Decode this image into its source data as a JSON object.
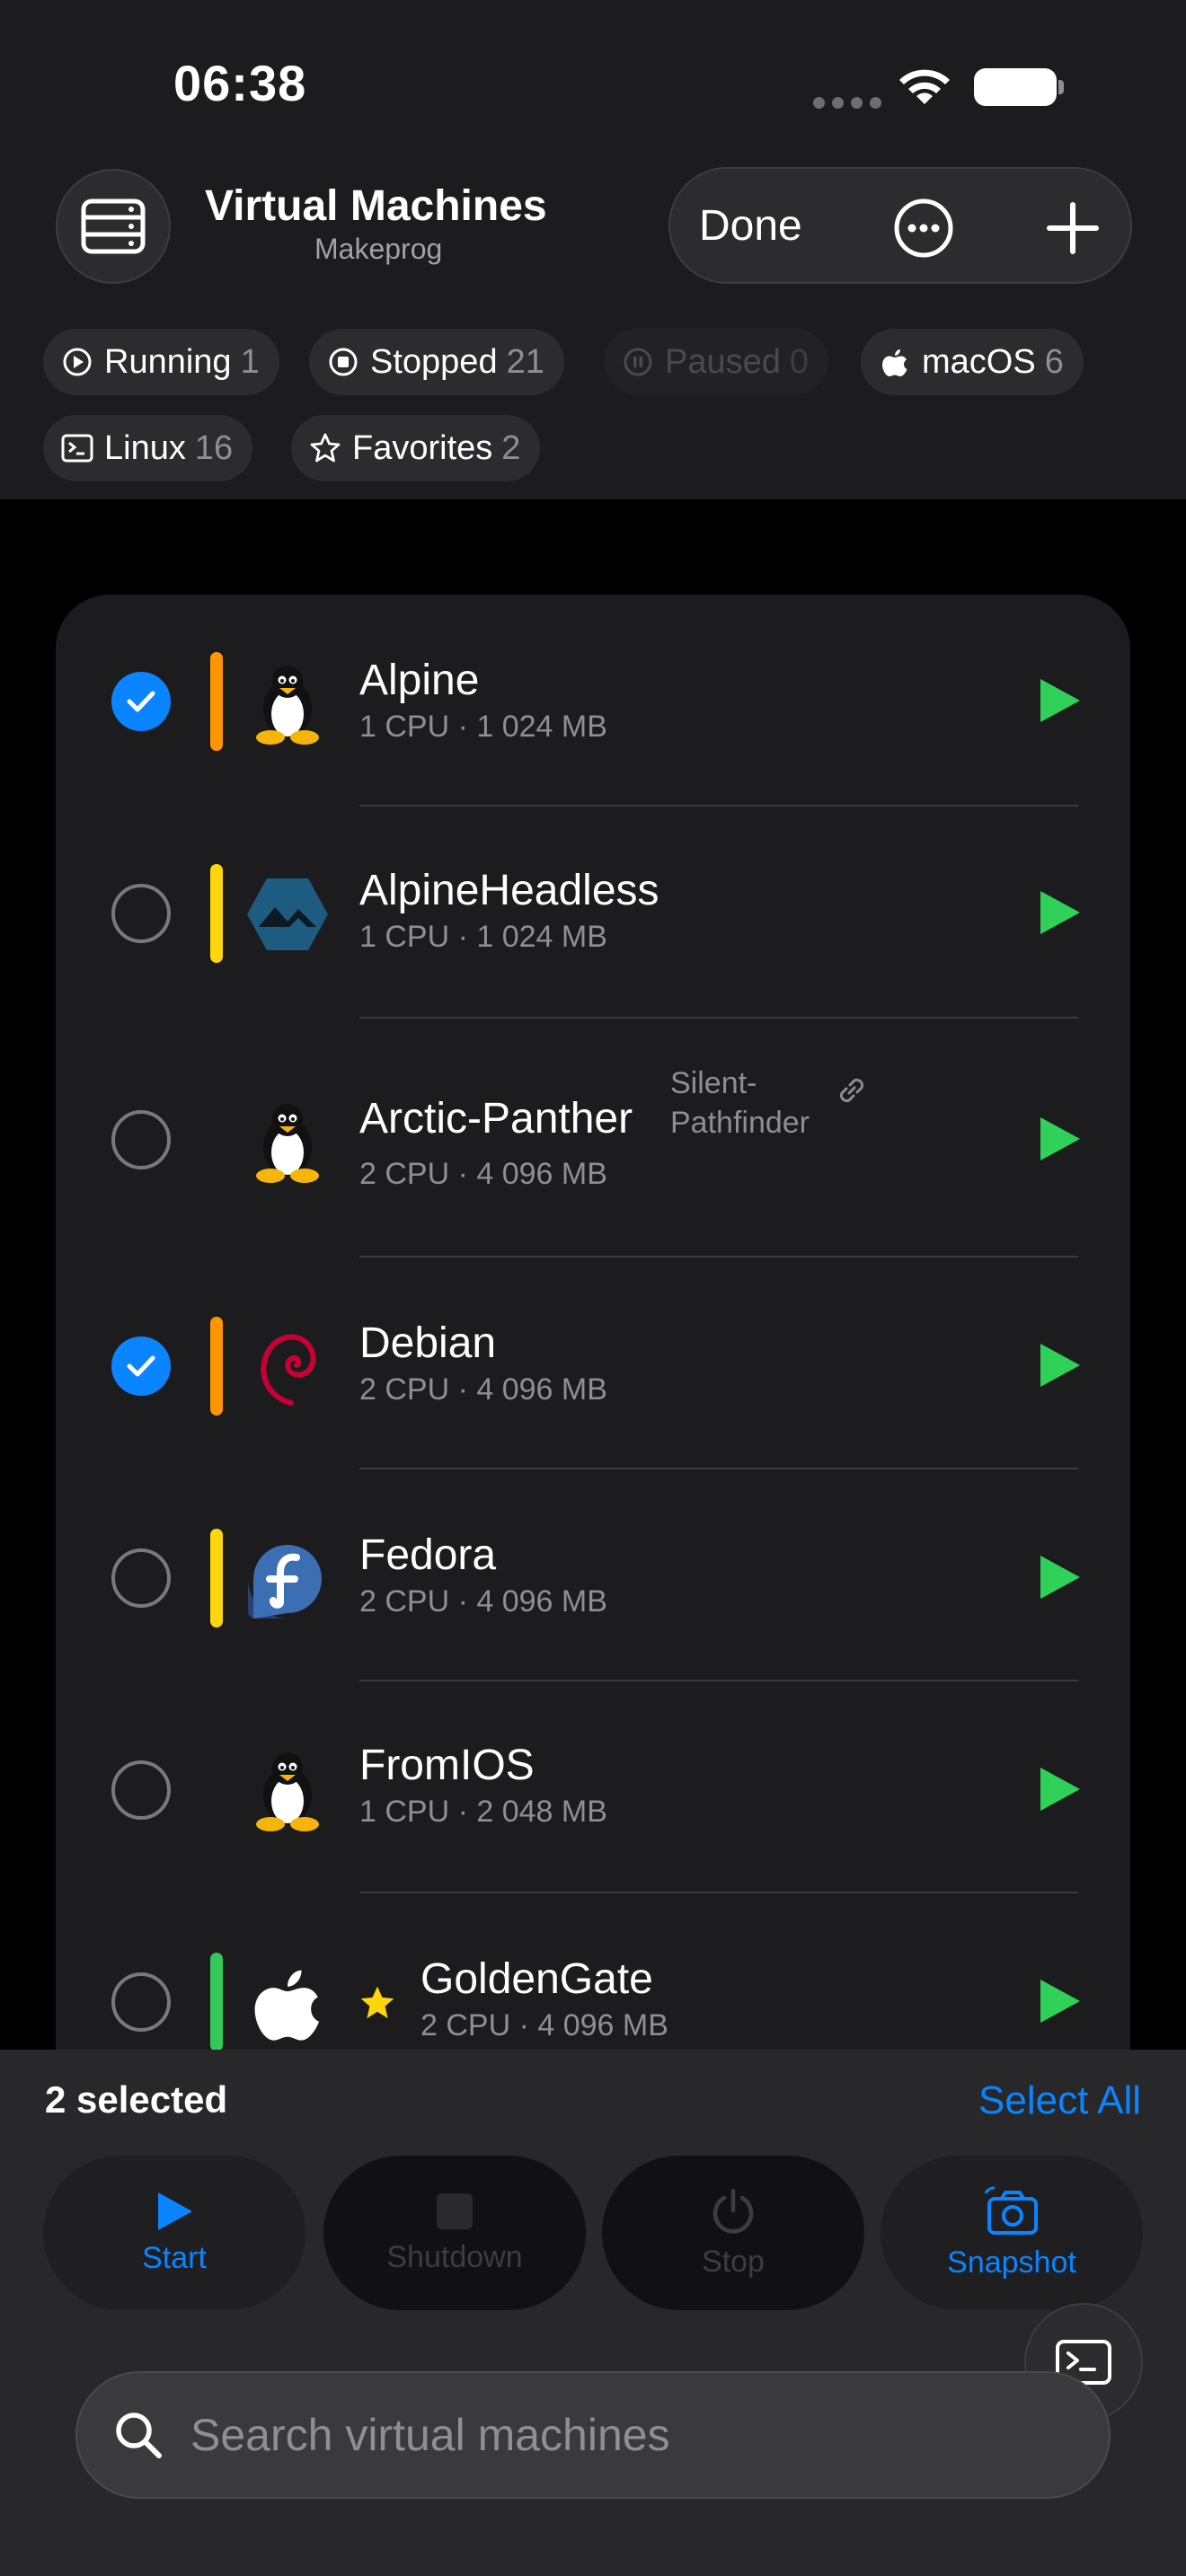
{
  "status_bar": {
    "time": "06:38"
  },
  "header": {
    "title": "Virtual Machines",
    "subtitle": "Makeprog",
    "done_label": "Done",
    "more_icon": "ellipsis-circle-icon",
    "add_icon": "plus-icon",
    "server_icon": "server-rack-icon"
  },
  "filters": [
    {
      "label": "Running",
      "count": "1",
      "icon": "play-circle-icon",
      "enabled": true
    },
    {
      "label": "Stopped",
      "count": "21",
      "icon": "stop-circle-icon",
      "enabled": true
    },
    {
      "label": "Paused",
      "count": "0",
      "icon": "pause-circle-icon",
      "enabled": false
    },
    {
      "label": "macOS",
      "count": "6",
      "icon": "apple-icon",
      "enabled": true
    },
    {
      "label": "Linux",
      "count": "16",
      "icon": "terminal-icon",
      "enabled": true
    },
    {
      "label": "Favorites",
      "count": "2",
      "icon": "star-icon",
      "enabled": true
    }
  ],
  "vms": [
    {
      "name": "Alpine",
      "spec": "1 CPU · 1 024 MB",
      "selected": true,
      "tag_color": "#ff9500",
      "os": "linux-tux"
    },
    {
      "name": "AlpineHeadless",
      "spec": "1 CPU · 1 024 MB",
      "selected": false,
      "tag_color": "#ffd60a",
      "os": "alpine"
    },
    {
      "name": "Arctic-Panther",
      "spec": "2 CPU · 4 096 MB",
      "selected": false,
      "tag_color": null,
      "os": "linux-tux",
      "remote_host_line1": "Silent-",
      "remote_host_line2": "Pathfinder"
    },
    {
      "name": "Debian",
      "spec": "2 CPU · 4 096 MB",
      "selected": true,
      "tag_color": "#ff9500",
      "os": "debian"
    },
    {
      "name": "Fedora",
      "spec": "2 CPU · 4 096 MB",
      "selected": false,
      "tag_color": "#ffd60a",
      "os": "fedora"
    },
    {
      "name": "FromIOS",
      "spec": "1 CPU · 2 048 MB",
      "selected": false,
      "tag_color": null,
      "os": "linux-tux"
    },
    {
      "name": "GoldenGate",
      "spec": "2 CPU · 4 096 MB",
      "selected": false,
      "tag_color": "#34c759",
      "os": "apple",
      "favorite": true
    }
  ],
  "toolbar": {
    "selected_text": "2 selected",
    "select_all_label": "Select All",
    "actions": [
      {
        "label": "Start",
        "icon": "play-icon",
        "enabled": true
      },
      {
        "label": "Shutdown",
        "icon": "stop-square-icon",
        "enabled": false
      },
      {
        "label": "Stop",
        "icon": "power-icon",
        "enabled": false
      },
      {
        "label": "Snapshot",
        "icon": "camera-icon",
        "enabled": true
      }
    ],
    "terminal_icon": "terminal-icon"
  },
  "search": {
    "placeholder": "Search virtual machines",
    "value": ""
  },
  "colors": {
    "accent": "#0a84ff",
    "play": "#30d158",
    "favorite": "#ffd60a"
  }
}
